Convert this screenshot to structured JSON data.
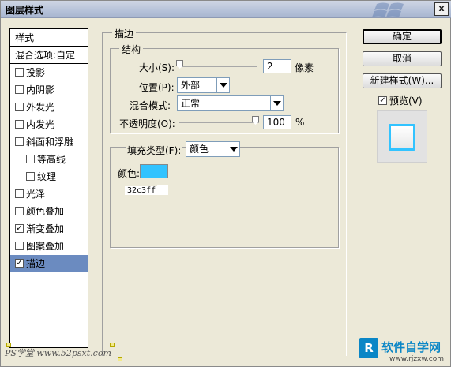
{
  "window": {
    "title": "图层样式",
    "close_label": "x"
  },
  "styles_list": {
    "header": "样式",
    "blend_options": "混合选项:自定",
    "items": [
      {
        "label": "投影",
        "checked": false,
        "sub": false,
        "selected": false
      },
      {
        "label": "内阴影",
        "checked": false,
        "sub": false,
        "selected": false
      },
      {
        "label": "外发光",
        "checked": false,
        "sub": false,
        "selected": false
      },
      {
        "label": "内发光",
        "checked": false,
        "sub": false,
        "selected": false
      },
      {
        "label": "斜面和浮雕",
        "checked": false,
        "sub": false,
        "selected": false
      },
      {
        "label": "等高线",
        "checked": false,
        "sub": true,
        "selected": false
      },
      {
        "label": "纹理",
        "checked": false,
        "sub": true,
        "selected": false
      },
      {
        "label": "光泽",
        "checked": false,
        "sub": false,
        "selected": false
      },
      {
        "label": "颜色叠加",
        "checked": false,
        "sub": false,
        "selected": false
      },
      {
        "label": "渐变叠加",
        "checked": true,
        "sub": false,
        "selected": false
      },
      {
        "label": "图案叠加",
        "checked": false,
        "sub": false,
        "selected": false
      },
      {
        "label": "描边",
        "checked": true,
        "sub": false,
        "selected": true
      }
    ]
  },
  "stroke": {
    "section_title": "描边",
    "structure": {
      "title": "结构",
      "size_label": "大小(S):",
      "size_value": "2",
      "size_unit": "像素",
      "position_label": "位置(P):",
      "position_value": "外部",
      "blend_mode_label": "混合模式:",
      "blend_mode_value": "正常",
      "opacity_label": "不透明度(O):",
      "opacity_value": "100",
      "opacity_unit": "%"
    },
    "fill": {
      "fill_type_label": "填充类型(F):",
      "fill_type_value": "颜色",
      "color_label": "颜色:",
      "color_hex": "32c3ff",
      "color_swatch": "#32c3ff"
    }
  },
  "buttons": {
    "ok": "确定",
    "cancel": "取消",
    "new_style": "新建样式(W)...",
    "preview_label": "预览(V)",
    "preview_checked": true
  },
  "watermarks": {
    "left": "PS学堂 www.52psxt.com",
    "right_logo": "R",
    "right_brand": "软件自学网",
    "right_url": "www.rjzxw.com"
  },
  "icons": {
    "close": "close-icon",
    "checkbox": "checkbox-icon",
    "dropdown": "chevron-down-icon",
    "windows_logo": "windows-logo-icon"
  }
}
